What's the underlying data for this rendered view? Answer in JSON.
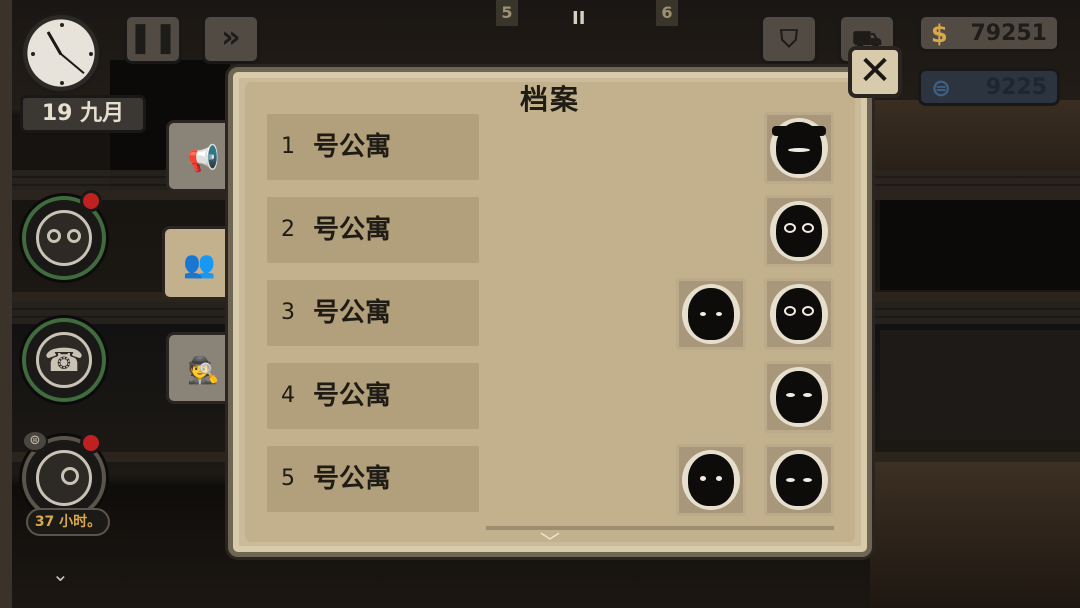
{
  "hud": {
    "date_label": "19 九月",
    "pause_icon": "pause-icon",
    "fast_forward_icon": "fast-forward-icon",
    "floor_left": "5",
    "floor_right": "6",
    "pause_mini": "II",
    "bag_icon": "bag-icon",
    "cart_icon": "cart-icon",
    "money_symbol": "$",
    "money_value": "79251",
    "reputation_value": "9225"
  },
  "sidebar": {
    "timer_label": "37 小时。"
  },
  "dialog": {
    "title": "档案",
    "close_label": "✕",
    "scroll_up": "︿",
    "scroll_down": "﹀",
    "tabs": [
      {
        "name": "tab-reports",
        "icon": "megaphone-icon",
        "active": false
      },
      {
        "name": "tab-tenants",
        "icon": "people-icon",
        "active": true
      },
      {
        "name": "tab-wanted",
        "icon": "detective-icon",
        "active": false
      }
    ],
    "apartments": [
      {
        "number": "1",
        "label": "号公寓",
        "tenants": [
          "hat-man-portrait"
        ]
      },
      {
        "number": "2",
        "label": "号公寓",
        "tenants": [
          "glasses-man-portrait"
        ]
      },
      {
        "number": "3",
        "label": "号公寓",
        "tenants": [
          "girl-portrait",
          "curly-glasses-man-portrait"
        ]
      },
      {
        "number": "4",
        "label": "号公寓",
        "tenants": [
          "bald-man-portrait"
        ]
      },
      {
        "number": "5",
        "label": "号公寓",
        "tenants": [
          "blob-portrait",
          "hooded-man-portrait"
        ]
      }
    ]
  },
  "colors": {
    "panel": "#cbbb9a",
    "row": "#b29f7c",
    "text": "#1f1b15",
    "gold": "#d8a84a",
    "alert_red": "#c02020"
  }
}
